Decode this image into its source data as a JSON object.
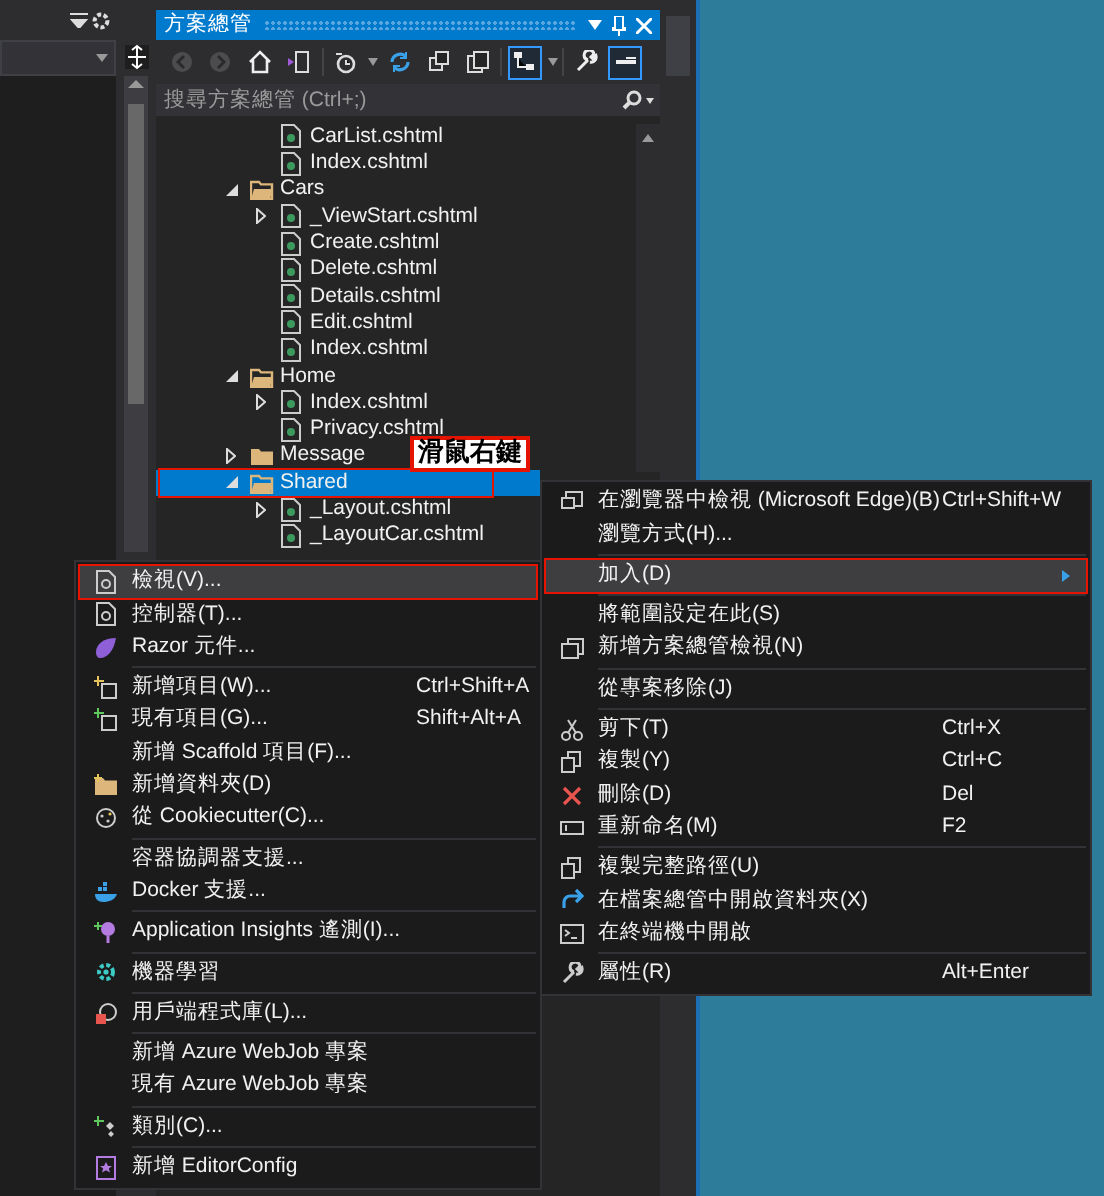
{
  "solution_explorer": {
    "title": "方案總管",
    "toolbar": [
      {
        "disabled": true,
        "on": false
      },
      {
        "disabled": true,
        "on": false
      },
      {
        "disabled": false,
        "on": false
      },
      {
        "disabled": false,
        "on": false
      },
      {
        "disabled": false,
        "on": false
      },
      {
        "disabled": false,
        "on": false
      },
      {
        "disabled": false,
        "on": false
      },
      {
        "disabled": false,
        "on": false
      },
      {
        "disabled": false,
        "on": true
      },
      {
        "disabled": false,
        "on": false
      },
      {
        "disabled": false,
        "on": true
      }
    ],
    "search": {
      "placeholder": "搜尋方案總管 (Ctrl+;)"
    },
    "tree": [
      {
        "kind": "tail",
        "children": [
          {
            "kind": "file",
            "label": "CarList.cshtml",
            "selected": false
          },
          {
            "kind": "file",
            "label": "Index.cshtml",
            "selected": false
          }
        ]
      },
      {
        "kind": "folder",
        "label": "Cars",
        "expanded": true,
        "selected": false,
        "children": [
          {
            "kind": "file",
            "label": "_ViewStart.cshtml",
            "expanded": false,
            "selected": false
          },
          {
            "kind": "file",
            "label": "Create.cshtml",
            "selected": false
          },
          {
            "kind": "file",
            "label": "Delete.cshtml",
            "selected": false
          },
          {
            "kind": "file",
            "label": "Details.cshtml",
            "selected": false
          },
          {
            "kind": "file",
            "label": "Edit.cshtml",
            "selected": false
          },
          {
            "kind": "file",
            "label": "Index.cshtml",
            "selected": false
          }
        ]
      },
      {
        "kind": "folder",
        "label": "Home",
        "expanded": true,
        "selected": false,
        "children": [
          {
            "kind": "file",
            "label": "Index.cshtml",
            "expanded": false,
            "selected": false
          },
          {
            "kind": "file",
            "label": "Privacy.cshtml",
            "selected": false
          }
        ]
      },
      {
        "kind": "folder",
        "label": "Message",
        "expanded": false,
        "selected": false
      },
      {
        "kind": "folder",
        "label": "Shared",
        "expanded": true,
        "selected": true,
        "children": [
          {
            "kind": "file",
            "label": "_Layout.cshtml",
            "expanded": false,
            "selected": false
          },
          {
            "kind": "file",
            "label": "_LayoutCar.cshtml",
            "selected": false
          }
        ]
      }
    ]
  },
  "annotation": "滑鼠右鍵",
  "context_menu": [
    {
      "kind": "item",
      "label": "在瀏覽器中檢視 (Microsoft Edge)(B)",
      "shortcut": "Ctrl+Shift+W",
      "selected": false
    },
    {
      "kind": "item",
      "label": "瀏覽方式(H)...",
      "selected": false
    },
    {
      "kind": "separator"
    },
    {
      "kind": "submenu",
      "label": "加入(D)",
      "selected": true
    },
    {
      "kind": "separator"
    },
    {
      "kind": "item",
      "label": "將範圍設定在此(S)",
      "selected": false
    },
    {
      "kind": "item",
      "label": "新增方案總管檢視(N)",
      "selected": false
    },
    {
      "kind": "separator"
    },
    {
      "kind": "item",
      "label": "從專案移除(J)",
      "selected": false
    },
    {
      "kind": "separator"
    },
    {
      "kind": "item",
      "label": "剪下(T)",
      "shortcut": "Ctrl+X",
      "selected": false
    },
    {
      "kind": "item",
      "label": "複製(Y)",
      "shortcut": "Ctrl+C",
      "selected": false
    },
    {
      "kind": "item",
      "label": "刪除(D)",
      "shortcut": "Del",
      "selected": false
    },
    {
      "kind": "item",
      "label": "重新命名(M)",
      "shortcut": "F2",
      "selected": false
    },
    {
      "kind": "separator"
    },
    {
      "kind": "item",
      "label": "複製完整路徑(U)",
      "selected": false
    },
    {
      "kind": "item",
      "label": "在檔案總管中開啟資料夾(X)",
      "selected": false
    },
    {
      "kind": "item",
      "label": "在終端機中開啟",
      "selected": false
    },
    {
      "kind": "separator"
    },
    {
      "kind": "item",
      "label": "屬性(R)",
      "shortcut": "Alt+Enter",
      "selected": false
    }
  ],
  "add_submenu": [
    {
      "kind": "item",
      "label": "檢視(V)...",
      "selected": true
    },
    {
      "kind": "item",
      "label": "控制器(T)...",
      "selected": false
    },
    {
      "kind": "item",
      "label": "Razor 元件...",
      "selected": false
    },
    {
      "kind": "separator"
    },
    {
      "kind": "item",
      "label": "新增項目(W)...",
      "shortcut": "Ctrl+Shift+A",
      "selected": false
    },
    {
      "kind": "item",
      "label": "現有項目(G)...",
      "shortcut": "Shift+Alt+A",
      "selected": false
    },
    {
      "kind": "item",
      "label": "新增 Scaffold 項目(F)...",
      "selected": false
    },
    {
      "kind": "item",
      "label": "新增資料夾(D)",
      "selected": false
    },
    {
      "kind": "item",
      "label": "從 Cookiecutter(C)...",
      "selected": false
    },
    {
      "kind": "separator"
    },
    {
      "kind": "item",
      "label": "容器協調器支援...",
      "selected": false
    },
    {
      "kind": "item",
      "label": "Docker 支援...",
      "selected": false
    },
    {
      "kind": "separator"
    },
    {
      "kind": "item",
      "label": "Application Insights 遙測(I)...",
      "selected": false
    },
    {
      "kind": "separator"
    },
    {
      "kind": "item",
      "label": "機器學習",
      "selected": false
    },
    {
      "kind": "separator"
    },
    {
      "kind": "item",
      "label": "用戶端程式庫(L)...",
      "selected": false
    },
    {
      "kind": "separator"
    },
    {
      "kind": "item",
      "label": "新增 Azure WebJob 專案",
      "selected": false
    },
    {
      "kind": "item",
      "label": "現有 Azure WebJob 專案",
      "selected": false
    },
    {
      "kind": "separator"
    },
    {
      "kind": "item",
      "label": "類別(C)...",
      "selected": false
    },
    {
      "kind": "separator"
    },
    {
      "kind": "item",
      "label": "新增 EditorConfig",
      "selected": false
    }
  ]
}
